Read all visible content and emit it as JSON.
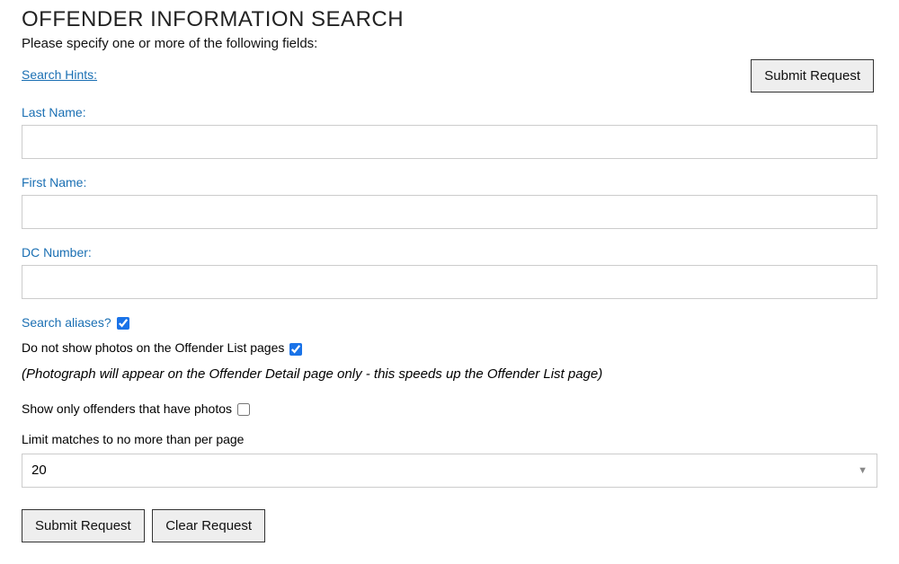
{
  "page_title": "OFFENDER INFORMATION SEARCH",
  "subtitle": "Please specify one or more of the following fields:",
  "hints_label": "Search Hints:",
  "fields": {
    "last_name": {
      "label": "Last Name:",
      "value": ""
    },
    "first_name": {
      "label": "First Name:",
      "value": ""
    },
    "dc_number": {
      "label": "DC Number:",
      "value": ""
    }
  },
  "aliases": {
    "label": "Search aliases?",
    "checked": true
  },
  "no_photos": {
    "label": "Do not show photos on the Offender List pages",
    "checked": true
  },
  "photo_note": "(Photograph will appear on the Offender Detail page only - this speeds up the Offender List page)",
  "only_photos": {
    "label": "Show only offenders that have photos",
    "checked": false
  },
  "limit": {
    "label": "Limit matches to no more than per page",
    "value": "20"
  },
  "buttons": {
    "submit": "Submit Request",
    "clear": "Clear Request"
  }
}
